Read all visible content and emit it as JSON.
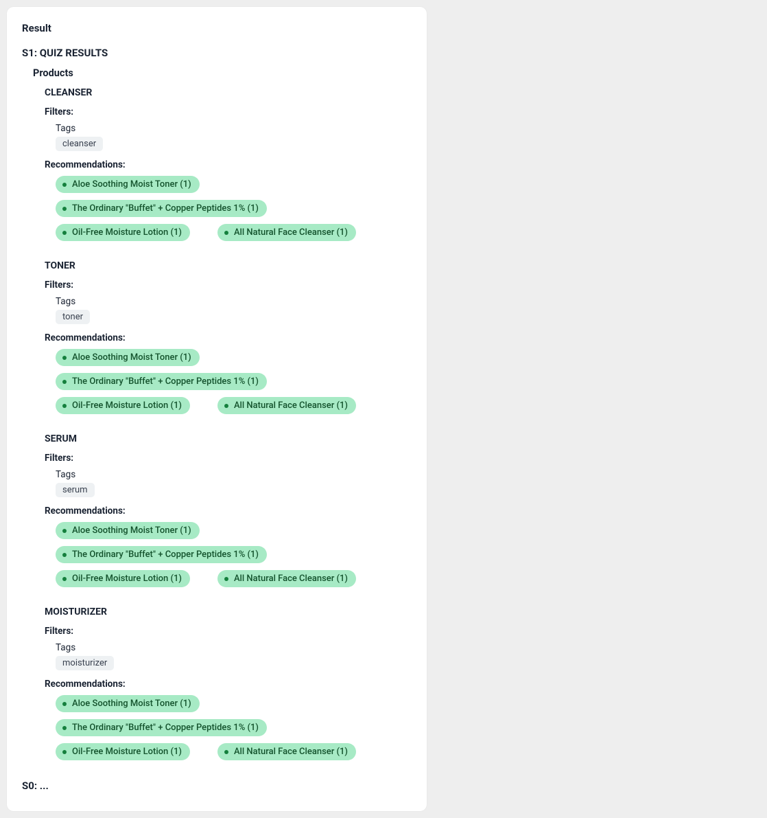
{
  "card": {
    "title": "Result",
    "section_title": "S1: QUIZ RESULTS",
    "products_label": "Products",
    "filters_label": "Filters:",
    "tags_label": "Tags",
    "recommendations_label": "Recommendations:",
    "footer": "S0: ..."
  },
  "categories": [
    {
      "title": "CLEANSER",
      "tag": "cleanser",
      "recommendations": [
        [
          "Aloe Soothing Moist Toner (1)"
        ],
        [
          "The Ordinary \"Buffet\" + Copper Peptides 1% (1)"
        ],
        [
          "Oil-Free Moisture Lotion (1)",
          "All Natural Face Cleanser (1)"
        ]
      ]
    },
    {
      "title": "TONER",
      "tag": "toner",
      "recommendations": [
        [
          "Aloe Soothing Moist Toner (1)"
        ],
        [
          "The Ordinary \"Buffet\" + Copper Peptides 1% (1)"
        ],
        [
          "Oil-Free Moisture Lotion (1)",
          "All Natural Face Cleanser (1)"
        ]
      ]
    },
    {
      "title": "SERUM",
      "tag": "serum",
      "recommendations": [
        [
          "Aloe Soothing Moist Toner (1)"
        ],
        [
          "The Ordinary \"Buffet\" + Copper Peptides 1% (1)"
        ],
        [
          "Oil-Free Moisture Lotion (1)",
          "All Natural Face Cleanser (1)"
        ]
      ]
    },
    {
      "title": "MOISTURIZER",
      "tag": "moisturizer",
      "recommendations": [
        [
          "Aloe Soothing Moist Toner (1)"
        ],
        [
          "The Ordinary \"Buffet\" + Copper Peptides 1% (1)"
        ],
        [
          "Oil-Free Moisture Lotion (1)",
          "All Natural Face Cleanser (1)"
        ]
      ]
    }
  ]
}
